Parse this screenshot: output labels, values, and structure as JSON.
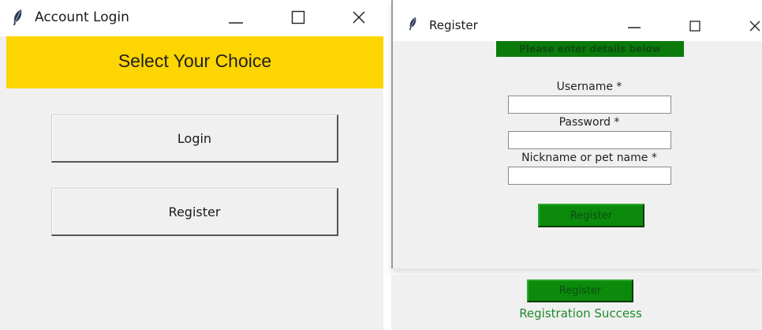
{
  "login_window": {
    "title": "Account Login",
    "header_text": "Select Your Choice",
    "header_color": "#fdd500",
    "buttons": {
      "login": "Login",
      "register": "Register"
    },
    "icons": [
      "feather-icon",
      "minimize-icon",
      "maximize-icon",
      "close-icon"
    ]
  },
  "register_window": {
    "title": "Register",
    "heading": "Please enter details below",
    "fields": {
      "username": {
        "label": "Username *",
        "value": ""
      },
      "password": {
        "label": "Password *",
        "value": ""
      },
      "nickname": {
        "label": "Nickname or pet name *",
        "value": ""
      }
    },
    "submit_label": "Register",
    "accent_color": "#0b8a0b",
    "icons": [
      "feather-icon",
      "minimize-icon",
      "maximize-icon",
      "close-icon"
    ]
  },
  "success_panel": {
    "button_label": "Register",
    "message": "Registration Success",
    "message_color": "#1f8a2a"
  }
}
